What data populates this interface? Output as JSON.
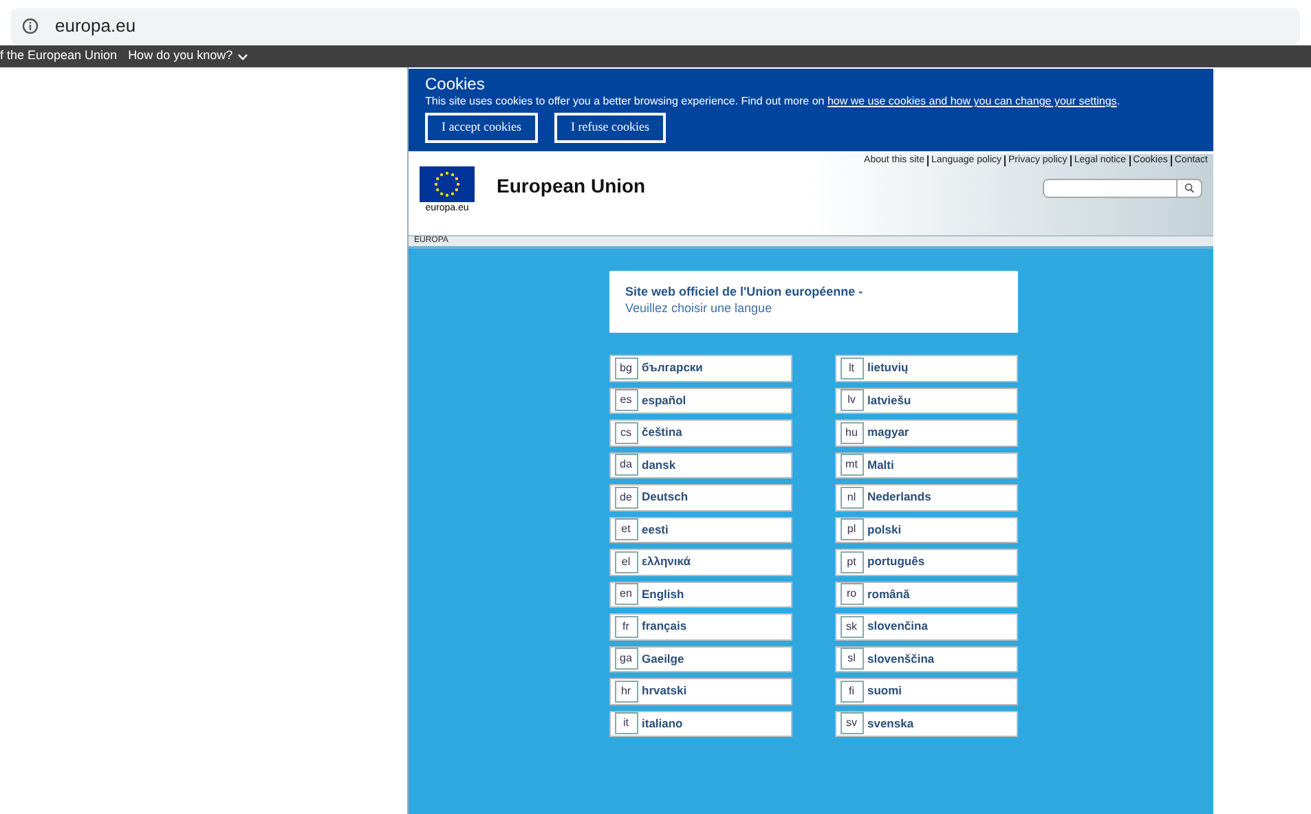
{
  "address_bar": {
    "url": "europa.eu"
  },
  "top_bar": {
    "title": "f the European Union",
    "menu": "How do you know?"
  },
  "cookies": {
    "title": "Cookies",
    "text": "This site uses cookies to offer you a better browsing experience. Find out more on ",
    "link": "how we use cookies and how you can change your settings",
    "after": ".",
    "buttons": [
      "I accept cookies",
      "I refuse cookies"
    ]
  },
  "header": {
    "links": [
      "About this site",
      "Language policy",
      "Privacy policy",
      "Legal notice",
      "Cookies",
      "Contact"
    ],
    "logo_caption": "europa.eu",
    "site_title": "European Union",
    "breadcrumb": "EUROPA"
  },
  "intro": {
    "title": "Site web officiel de l'Union européenne -",
    "subtitle": "Veuillez choisir une langue"
  },
  "languages": [
    [
      {
        "code": "bg",
        "name": "български"
      },
      {
        "code": "es",
        "name": "español"
      },
      {
        "code": "cs",
        "name": "čeština"
      },
      {
        "code": "da",
        "name": "dansk"
      },
      {
        "code": "de",
        "name": "Deutsch"
      },
      {
        "code": "et",
        "name": "eesti"
      },
      {
        "code": "el",
        "name": "ελληνικά"
      },
      {
        "code": "en",
        "name": "English"
      },
      {
        "code": "fr",
        "name": "français"
      },
      {
        "code": "ga",
        "name": "Gaeilge"
      },
      {
        "code": "hr",
        "name": "hrvatski"
      },
      {
        "code": "it",
        "name": "italiano"
      }
    ],
    [
      {
        "code": "lt",
        "name": "lietuvių"
      },
      {
        "code": "lv",
        "name": "latviešu"
      },
      {
        "code": "hu",
        "name": "magyar"
      },
      {
        "code": "mt",
        "name": "Malti"
      },
      {
        "code": "nl",
        "name": "Nederlands"
      },
      {
        "code": "pl",
        "name": "polski"
      },
      {
        "code": "pt",
        "name": "português"
      },
      {
        "code": "ro",
        "name": "română"
      },
      {
        "code": "sk",
        "name": "slovenčina"
      },
      {
        "code": "sl",
        "name": "slovenščina"
      },
      {
        "code": "fi",
        "name": "suomi"
      },
      {
        "code": "sv",
        "name": "svenska"
      }
    ]
  ]
}
